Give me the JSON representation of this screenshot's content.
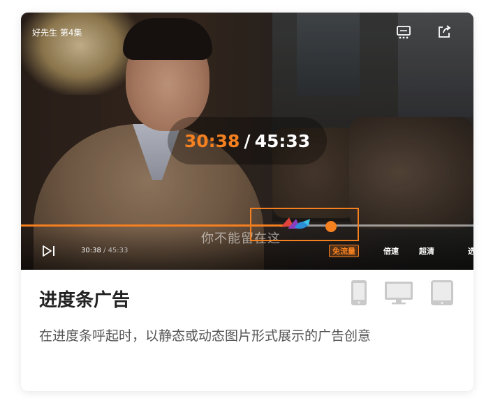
{
  "video": {
    "episode_title": "好先生 第4集",
    "overlay_time": {
      "current": "30:38",
      "separator": "/",
      "total": "45:33"
    },
    "subtitle": "你不能留在这",
    "progress_fraction": 0.586,
    "controls": {
      "time_current": "30:38",
      "time_separator": " / ",
      "time_total": "45:33",
      "free_data_label": "免流量",
      "speed_label": "倍速",
      "quality_label": "超清",
      "episodes_label": "选"
    },
    "icons": [
      "next-episode-icon",
      "danmaku-icon",
      "share-icon",
      "ad-logo-icon"
    ]
  },
  "card": {
    "title": "进度条广告",
    "description": "在进度条呼起时，以静态或动态图片形式展示的广告创意",
    "device_icons": [
      "phone-icon",
      "desktop-icon",
      "tablet-icon"
    ]
  },
  "colors": {
    "accent": "#f58020",
    "title_text": "#222222",
    "body_text": "#555555",
    "device_icon": "#c9c9c9"
  }
}
